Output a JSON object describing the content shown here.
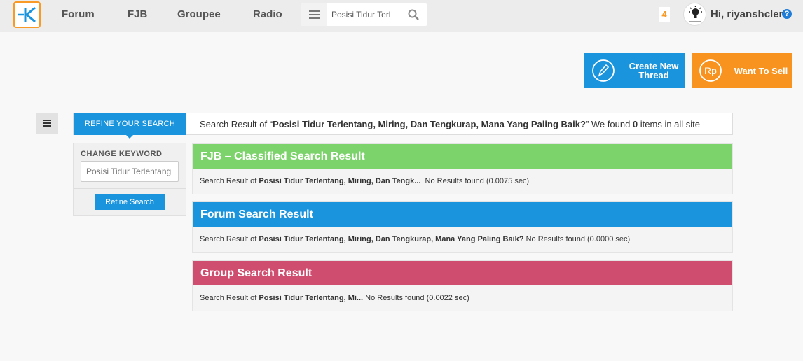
{
  "nav": {
    "items": [
      "Forum",
      "FJB",
      "Groupee",
      "Radio"
    ],
    "search_value": "Posisi Tidur Terl",
    "notification_count": "4",
    "greeting": "Hi, riyanshcler",
    "help": "?"
  },
  "actions": {
    "create_thread": "Create New Thread",
    "want_to_sell": "Want To Sell"
  },
  "refine": {
    "tab_label": "REFINE YOUR SEARCH",
    "summary_prefix": "Search Result of “",
    "query": "Posisi Tidur Terlentang, Miring, Dan Tengkurap, Mana Yang Paling Baik?",
    "summary_middle": "” We found ",
    "count": "0",
    "summary_suffix": " items in all site",
    "keyword_label": "CHANGE KEYWORD",
    "keyword_value": "Posisi Tidur Terlentang",
    "button": "Refine Search"
  },
  "results": [
    {
      "title": "FJB – Classified Search Result",
      "prefix": "Search Result of ",
      "query": "Posisi Tidur Terlentang, Miring, Dan Tengk...",
      "status": "  No Results found (0.0075 sec)",
      "color": "#7dd36b"
    },
    {
      "title": "Forum Search Result",
      "prefix": "Search Result of ",
      "query": "Posisi Tidur Terlentang, Miring, Dan Tengkurap, Mana Yang Paling Baik?",
      "status": " No Results found (0.0000 sec)",
      "color": "#1b94de"
    },
    {
      "title": "Group Search Result",
      "prefix": "Search Result of ",
      "query": "Posisi Tidur Terlentang, Mi...",
      "status": " No Results found (0.0022 sec)",
      "color": "#cf4e6f"
    }
  ]
}
